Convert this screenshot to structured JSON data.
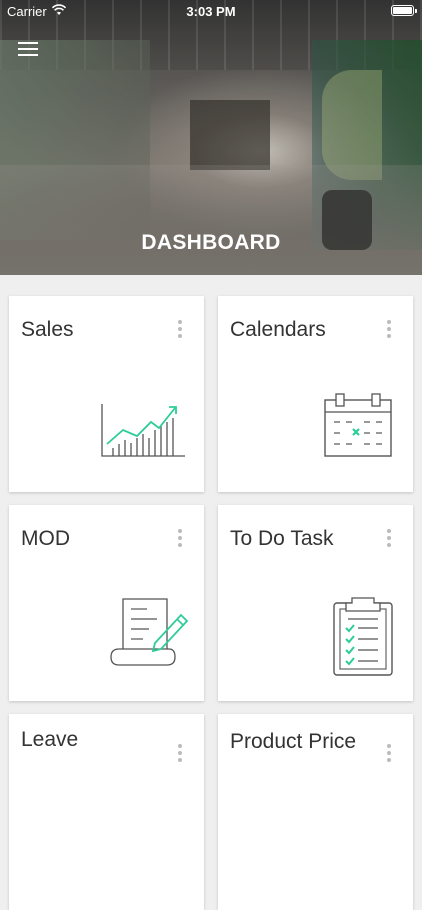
{
  "status_bar": {
    "carrier": "Carrier",
    "time": "3:03 PM"
  },
  "header": {
    "title": "DASHBOARD"
  },
  "cards": [
    {
      "label": "Sales",
      "icon": "sales-chart-icon"
    },
    {
      "label": "Calendars",
      "icon": "calendar-icon"
    },
    {
      "label": "MOD",
      "icon": "document-pen-icon"
    },
    {
      "label": "To Do Task",
      "icon": "clipboard-checklist-icon"
    },
    {
      "label": "Leave",
      "icon": ""
    },
    {
      "label": "Product Price",
      "icon": ""
    }
  ],
  "colors": {
    "accent": "#2ecc9a",
    "line": "#555555",
    "card_bg": "#ffffff",
    "page_bg": "#efefef"
  }
}
